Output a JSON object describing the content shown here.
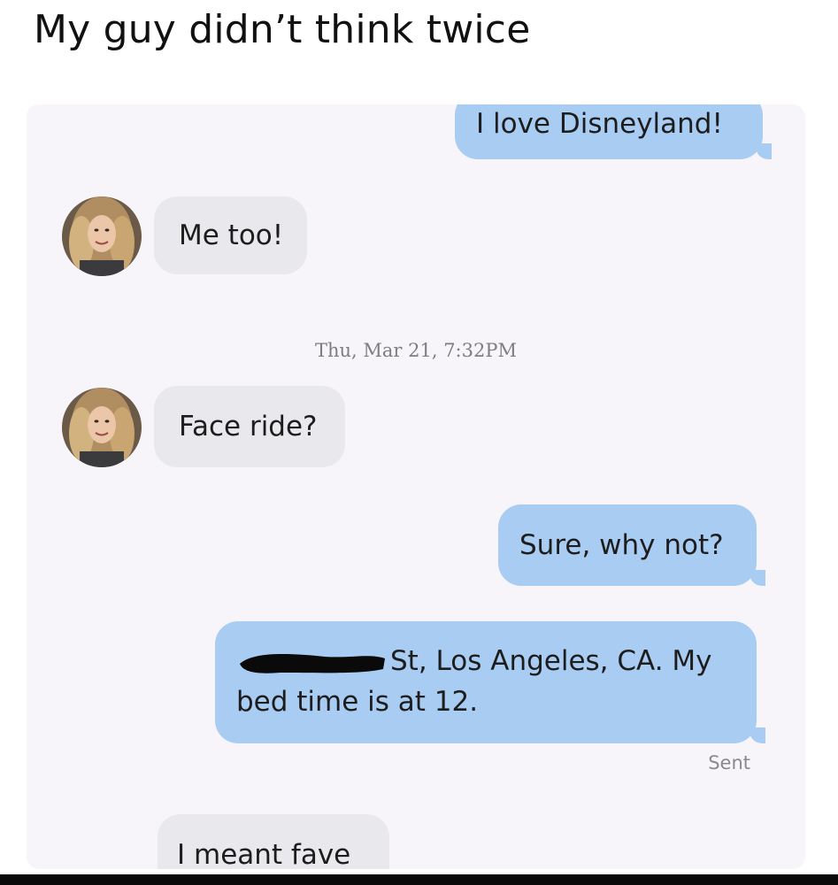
{
  "post": {
    "caption": "My guy didn’t think twice"
  },
  "conversation": {
    "timestamp": "Thu, Mar 21, 7:32PM",
    "delivery_status": "Sent",
    "messages": [
      {
        "direction": "sent",
        "text": "I love Disneyland!"
      },
      {
        "direction": "received",
        "text": "Me too!"
      },
      {
        "direction": "received",
        "text": "Face ride?"
      },
      {
        "direction": "sent",
        "text": "Sure, why not?"
      },
      {
        "direction": "sent",
        "text_line1": "St, Los Angeles, CA. My",
        "text_line2": "bed time is at 12.",
        "redacted_prefix": true
      },
      {
        "direction": "received",
        "text": "I meant fave"
      }
    ]
  },
  "colors": {
    "sent_bubble": "#a9cdf2",
    "received_bubble": "#e9e8ec",
    "background": "#f7f5f9",
    "redaction": "#0a0a0a"
  },
  "icons": {
    "contact_avatar": "avatar-photo-icon"
  }
}
